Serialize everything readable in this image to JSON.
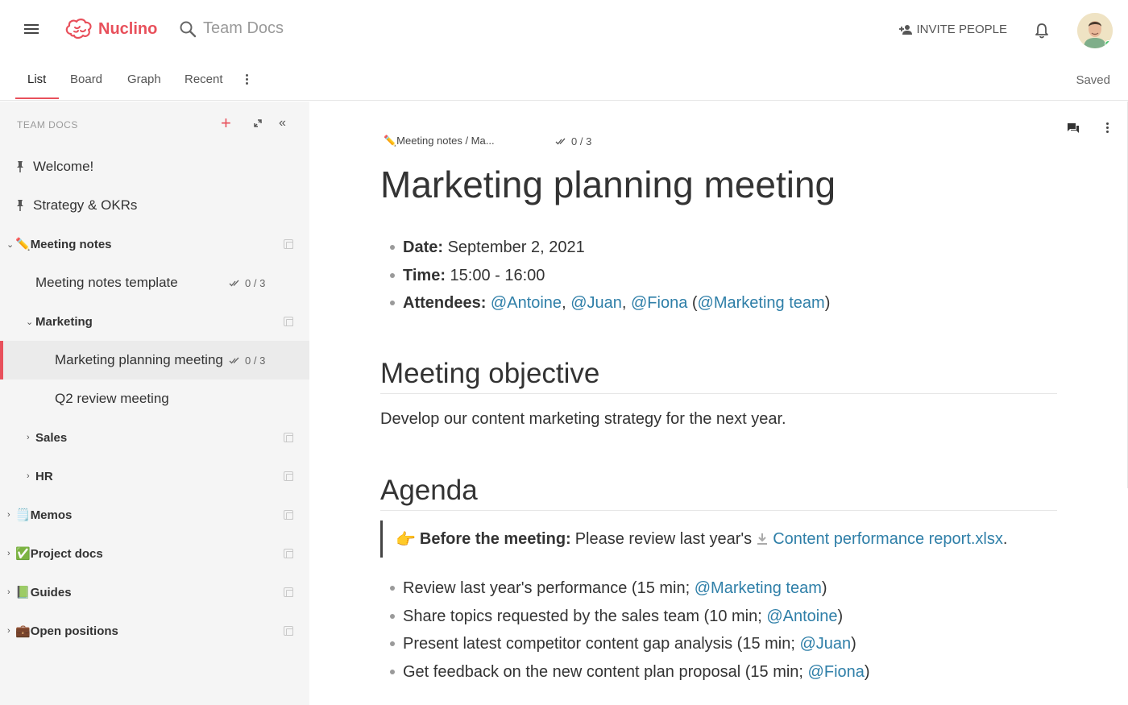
{
  "app": {
    "brand": "Nuclino",
    "search_label": "Team Docs"
  },
  "header": {
    "invite_label": "INVITE PEOPLE"
  },
  "tabs": [
    {
      "label": "List",
      "active": true
    },
    {
      "label": "Board"
    },
    {
      "label": "Graph"
    },
    {
      "label": "Recent"
    }
  ],
  "status": {
    "saved": "Saved"
  },
  "sidebar": {
    "header": "TEAM DOCS",
    "items": [
      {
        "label": "Welcome!",
        "pinned": true
      },
      {
        "label": "Strategy & OKRs",
        "pinned": true
      },
      {
        "label": "Meeting notes",
        "emoji": "✏️",
        "expanded": true
      },
      {
        "label": "Meeting notes template",
        "progress": "0 / 3"
      },
      {
        "label": "Marketing",
        "expanded": true
      },
      {
        "label": "Marketing planning meeting",
        "progress": "0 / 3",
        "selected": true
      },
      {
        "label": "Q2 review meeting"
      },
      {
        "label": "Sales"
      },
      {
        "label": "HR"
      },
      {
        "label": "Memos",
        "emoji": "🗒️"
      },
      {
        "label": "Project docs",
        "emoji": "✅"
      },
      {
        "label": "Guides",
        "emoji": "📗"
      },
      {
        "label": "Open positions",
        "emoji": "💼"
      }
    ]
  },
  "document": {
    "breadcrumb": "✏️Meeting notes / Ma...",
    "progress": "0 / 3",
    "title": "Marketing planning meeting",
    "date_label": "Date:",
    "date_value": " September 2, 2021",
    "time_label": "Time:",
    "time_value": " 15:00 - 16:00",
    "attendees_label": "Attendees:",
    "attendees": [
      "@Antoine",
      "@Juan",
      "@Fiona"
    ],
    "attendees_group": "@Marketing team",
    "objective_heading": "Meeting objective",
    "objective_text": "Develop our content marketing strategy for the next year.",
    "agenda_heading": "Agenda",
    "callout_emoji": "👉",
    "callout_label": "Before the meeting:",
    "callout_text": "Please review last year's",
    "callout_attachment": "Content performance report.xlsx",
    "agenda_items": [
      {
        "text": "Review last year's performance (15 min; ",
        "mention": "@Marketing team"
      },
      {
        "text": "Share topics requested by the sales team (10 min; ",
        "mention": "@Antoine"
      },
      {
        "text": "Present latest competitor content gap analysis (15 min; ",
        "mention": "@Juan"
      },
      {
        "text": "Get feedback on the new content plan proposal (15 min; ",
        "mention": "@Fiona"
      }
    ]
  },
  "colors": {
    "accent": "#e8505b",
    "link": "#2f7fa8",
    "online": "#4cc26e"
  }
}
